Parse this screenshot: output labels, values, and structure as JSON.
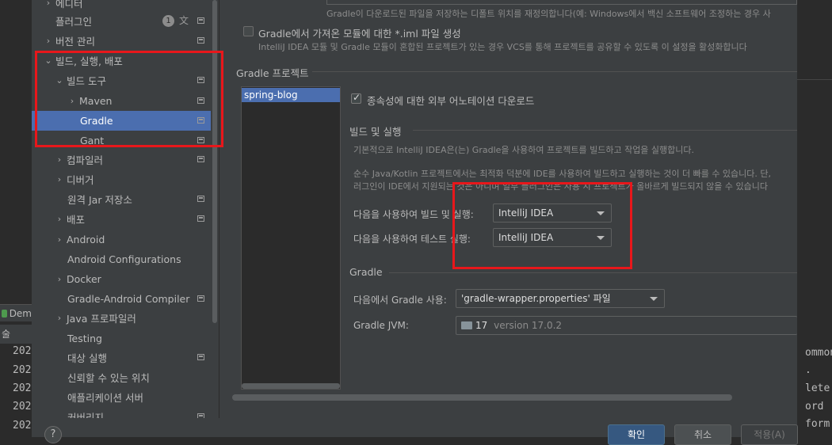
{
  "background": {
    "run_tab_label": "Dem",
    "console_header": "술",
    "log_lines": [
      "202",
      "202",
      "202",
      "202",
      "202"
    ],
    "right_lines": [
      "ommon",
      ".",
      "lete",
      "ord",
      "form"
    ]
  },
  "sidebar": {
    "items": [
      {
        "label": "에디터",
        "chevron": "›"
      },
      {
        "label": "플러그인",
        "badge": "1"
      },
      {
        "label": "버전 관리",
        "chevron": "›"
      },
      {
        "label": "빌드, 실행, 배포",
        "chevron": "⌄"
      },
      {
        "label": "빌드 도구",
        "chevron": "⌄"
      },
      {
        "label": "Maven",
        "chevron": "›"
      },
      {
        "label": "Gradle"
      },
      {
        "label": "Gant"
      },
      {
        "label": "컴파일러",
        "chevron": "›"
      },
      {
        "label": "디버거",
        "chevron": "›"
      },
      {
        "label": "원격 Jar 저장소"
      },
      {
        "label": "배포",
        "chevron": "›"
      },
      {
        "label": "Android",
        "chevron": "›"
      },
      {
        "label": "Android Configurations"
      },
      {
        "label": "Docker",
        "chevron": "›"
      },
      {
        "label": "Gradle-Android Compiler"
      },
      {
        "label": "Java 프로파일러",
        "chevron": "›"
      },
      {
        "label": "Testing"
      },
      {
        "label": "대상 실행"
      },
      {
        "label": "신뢰할 수 있는 위치"
      },
      {
        "label": "애플리케이션 서버"
      },
      {
        "label": "커버리지"
      }
    ]
  },
  "content": {
    "top_desc": "Gradle이 다운로드된 파일을 저장하는 디폴트 위치를 재정의합니다(예: Windows에서 백신 소프트웨어 조정하는 경우 사",
    "iml_checkbox_label": "Gradle에서 가져온 모듈에 대한 *.iml 파일 생성",
    "iml_desc": "IntelliJ IDEA 모듈 및 Gradle 모듈이 혼합된 프로젝트가 있는 경우 VCS를 통해 프로젝트를 공유할 수 있도록 이 설정을 활성화합니다",
    "projects_title": "Gradle 프로젝트",
    "projects": [
      "spring-blog"
    ],
    "download_sources_label": "종속성에 대한 외부 어노테이션 다운로드",
    "build_run_title": "빌드 및 실행",
    "build_run_desc1": "기본적으로 IntelliJ IDEA은(는) Gradle을 사용하여 프로젝트를 빌드하고 작업을 실행합니다.",
    "build_run_desc2": "순수 Java/Kotlin 프로젝트에서는 최적화 덕분에 IDE를 사용하여 빌드하고 실행하는 것이 더 빠를 수 있습니다. 단,",
    "build_run_desc3": "러그인이 IDE에서 지원되는 것은 아니며 일부 플러그인은 사용 시 프로젝트가 올바르게 빌드되지 않을 수 있습니다",
    "build_run_using_label": "다음을 사용하여 빌드 및 실행:",
    "build_run_using_value": "IntelliJ IDEA",
    "test_using_label": "다음을 사용하여 테스트 실행:",
    "test_using_value": "IntelliJ IDEA",
    "gradle_title": "Gradle",
    "gradle_using_label": "다음에서 Gradle 사용:",
    "gradle_using_value": "'gradle-wrapper.properties' 파일",
    "gradle_jvm_label": "Gradle JVM:",
    "gradle_jvm_value": "17",
    "gradle_jvm_version": "version 17.0.2"
  },
  "buttons": {
    "help": "?",
    "ok": "확인",
    "cancel": "취소",
    "apply": "적용(A)"
  },
  "colors": {
    "selection": "#4b6eaf",
    "annotation_red": "#e8171b",
    "dialog_bg": "#3c3f41"
  }
}
